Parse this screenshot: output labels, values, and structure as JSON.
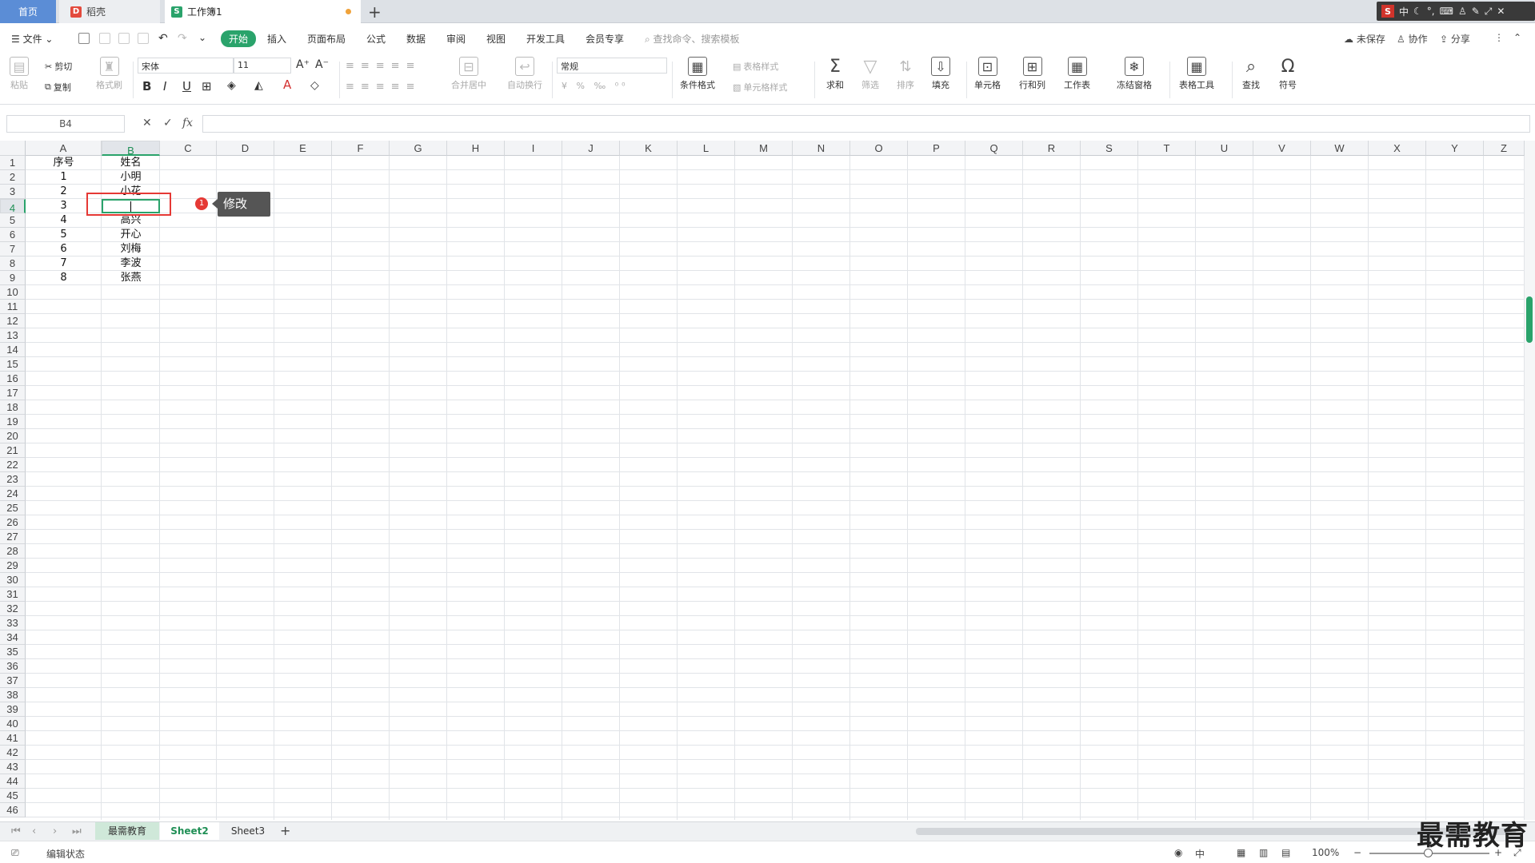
{
  "tabs": {
    "home": "首页",
    "doc": "稻壳",
    "book": "工作簿1",
    "new": "+"
  },
  "system": {
    "ime": "中",
    "s_label": "S"
  },
  "menu": {
    "file": "文件",
    "items": [
      "开始",
      "插入",
      "页面布局",
      "公式",
      "数据",
      "审阅",
      "视图",
      "开发工具",
      "会员专享"
    ],
    "search": "查找命令、搜索模板",
    "unsaved": "未保存",
    "collab": "协作",
    "share": "分享"
  },
  "ribbon": {
    "paste": "粘贴",
    "cut": "剪切",
    "copy": "复制",
    "format_painter": "格式刷",
    "font": "宋体",
    "size": "11",
    "merge": "合并居中",
    "wrap": "自动换行",
    "number_format": "常规",
    "cond_format": "条件格式",
    "table_style": "表格样式",
    "cell_style": "单元格样式",
    "sum": "求和",
    "filter": "筛选",
    "sort": "排序",
    "fill": "填充",
    "cell": "单元格",
    "rowcol": "行和列",
    "worksheet": "工作表",
    "freeze": "冻结窗格",
    "table_tools": "表格工具",
    "find": "查找",
    "symbol": "符号"
  },
  "formula_bar": {
    "name_box": "B4",
    "cancel": "✕",
    "confirm": "✓",
    "fx": "fx",
    "value": ""
  },
  "columns": [
    "A",
    "B",
    "C",
    "D",
    "E",
    "F",
    "G",
    "H",
    "I",
    "J",
    "K",
    "L",
    "M",
    "N",
    "O",
    "P",
    "Q",
    "R",
    "S",
    "T",
    "U",
    "V",
    "W",
    "X",
    "Y",
    "Z"
  ],
  "rows": [
    "1",
    "2",
    "3",
    "4",
    "5",
    "6",
    "7",
    "8",
    "9",
    "10",
    "11",
    "12",
    "13",
    "14",
    "15",
    "16",
    "17",
    "18",
    "19",
    "20",
    "21",
    "22",
    "23",
    "24",
    "25",
    "26",
    "27",
    "28",
    "29",
    "30",
    "31",
    "32",
    "33",
    "34",
    "35",
    "36",
    "37",
    "38",
    "39",
    "40",
    "41",
    "42",
    "43",
    "44",
    "45",
    "46"
  ],
  "cells": {
    "A": [
      "序号",
      "1",
      "2",
      "3",
      "4",
      "5",
      "6",
      "7",
      "8"
    ],
    "B": [
      "姓名",
      "小明",
      "小花",
      "",
      "高兴",
      "开心",
      "刘梅",
      "李波",
      "张燕"
    ]
  },
  "annotation": {
    "badge": "1",
    "label": "修改"
  },
  "sheet_tabs": [
    "最需教育",
    "Sheet2",
    "Sheet3"
  ],
  "add_sheet": "+",
  "status": {
    "mode": "编辑状态",
    "zoom": "100%"
  },
  "watermark": "最需教育",
  "colors": {
    "accent": "#2aa36b",
    "home_tab": "#5b8dd6",
    "highlight": "#e53935"
  }
}
